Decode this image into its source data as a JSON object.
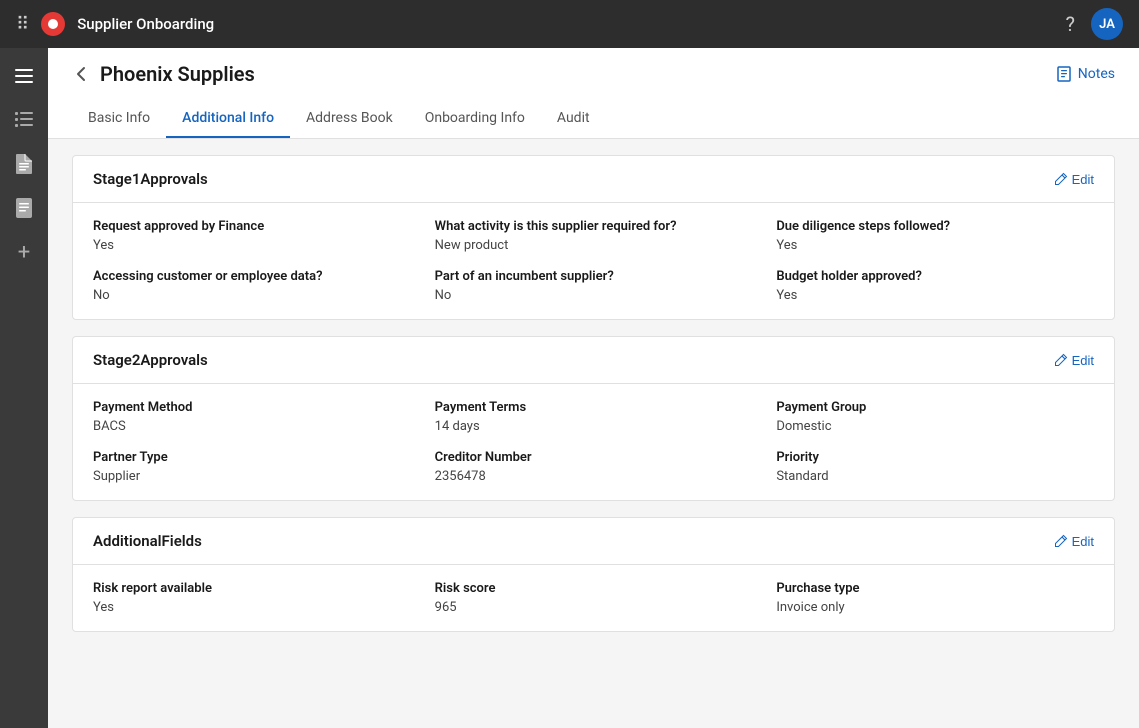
{
  "topbar": {
    "title": "Supplier Onboarding",
    "avatar_initials": "JA"
  },
  "page": {
    "back_label": "←",
    "title": "Phoenix Supplies",
    "notes_label": "Notes"
  },
  "tabs": [
    {
      "id": "basic-info",
      "label": "Basic Info",
      "active": false
    },
    {
      "id": "additional-info",
      "label": "Additional Info",
      "active": true
    },
    {
      "id": "address-book",
      "label": "Address Book",
      "active": false
    },
    {
      "id": "onboarding-info",
      "label": "Onboarding Info",
      "active": false
    },
    {
      "id": "audit",
      "label": "Audit",
      "active": false
    }
  ],
  "sections": [
    {
      "id": "stage1approvals",
      "title": "Stage1Approvals",
      "edit_label": "Edit",
      "rows": [
        [
          {
            "label": "Request approved by Finance",
            "value": "Yes"
          },
          {
            "label": "What activity is this supplier required for?",
            "value": "New product"
          },
          {
            "label": "Due diligence steps followed?",
            "value": "Yes"
          }
        ],
        [
          {
            "label": "Accessing customer or employee data?",
            "value": "No"
          },
          {
            "label": "Part of an incumbent supplier?",
            "value": "No"
          },
          {
            "label": "Budget holder approved?",
            "value": "Yes"
          }
        ]
      ]
    },
    {
      "id": "stage2approvals",
      "title": "Stage2Approvals",
      "edit_label": "Edit",
      "rows": [
        [
          {
            "label": "Payment Method",
            "value": "BACS"
          },
          {
            "label": "Payment Terms",
            "value": "14 days"
          },
          {
            "label": "Payment Group",
            "value": "Domestic"
          }
        ],
        [
          {
            "label": "Partner Type",
            "value": "Supplier"
          },
          {
            "label": "Creditor Number",
            "value": "2356478"
          },
          {
            "label": "Priority",
            "value": "Standard"
          }
        ]
      ]
    },
    {
      "id": "additionalfields",
      "title": "AdditionalFields",
      "edit_label": "Edit",
      "rows": [
        [
          {
            "label": "Risk report available",
            "value": "Yes"
          },
          {
            "label": "Risk score",
            "value": "965"
          },
          {
            "label": "Purchase type",
            "value": "Invoice only"
          }
        ]
      ]
    }
  ],
  "sidebar_icons": [
    {
      "id": "menu",
      "symbol": "☰"
    },
    {
      "id": "list",
      "symbol": "≡"
    },
    {
      "id": "file-alt",
      "symbol": "📄"
    },
    {
      "id": "file",
      "symbol": "🗒"
    },
    {
      "id": "plus",
      "symbol": "+"
    }
  ]
}
